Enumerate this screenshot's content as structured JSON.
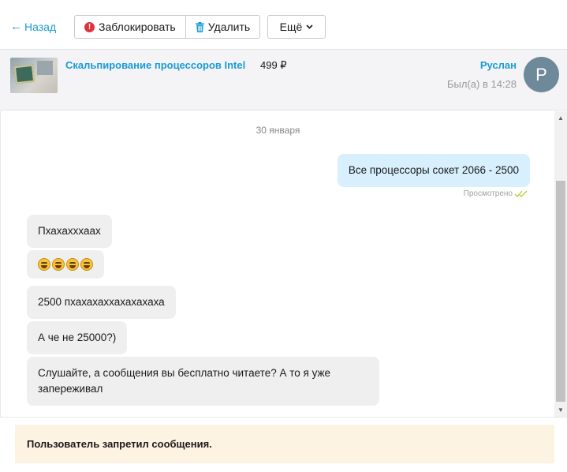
{
  "toolbar": {
    "back_label": "Назад",
    "back_arrow": "←",
    "block_label": "Заблокировать",
    "delete_label": "Удалить",
    "more_label": "Ещё"
  },
  "item": {
    "title": "Скальпирование процессоров Intel",
    "price": "499 ₽"
  },
  "user": {
    "name": "Руслан",
    "status": "Был(а) в 14:28",
    "avatar_letter": "P"
  },
  "chat": {
    "date": "30 января",
    "seen_label": "Просмотрено",
    "messages": [
      {
        "direction": "out",
        "text": "Все процессоры сокет 2066 - 2500"
      },
      {
        "direction": "in",
        "text": "Пхахахххаах"
      },
      {
        "direction": "in",
        "emoji": [
          "rofl-emoji",
          "rofl-emoji",
          "rofl-emoji",
          "rofl-emoji"
        ]
      },
      {
        "direction": "in",
        "text": "2500 пхахахаххахахахаха"
      },
      {
        "direction": "in",
        "text": "А че не 25000?)"
      },
      {
        "direction": "in",
        "text": "Слушайте, а сообщения вы бесплатно читаете? А то я уже запереживал"
      }
    ]
  },
  "notice": "Пользователь запретил сообщения.",
  "colors": {
    "accent": "#1a9bd6",
    "outgoing_bubble": "#d8f0fd",
    "incoming_bubble": "#efefef",
    "notice_bg": "#fdf3e2",
    "block_icon": "#e0323d",
    "seen_check": "#b5cf3a"
  }
}
